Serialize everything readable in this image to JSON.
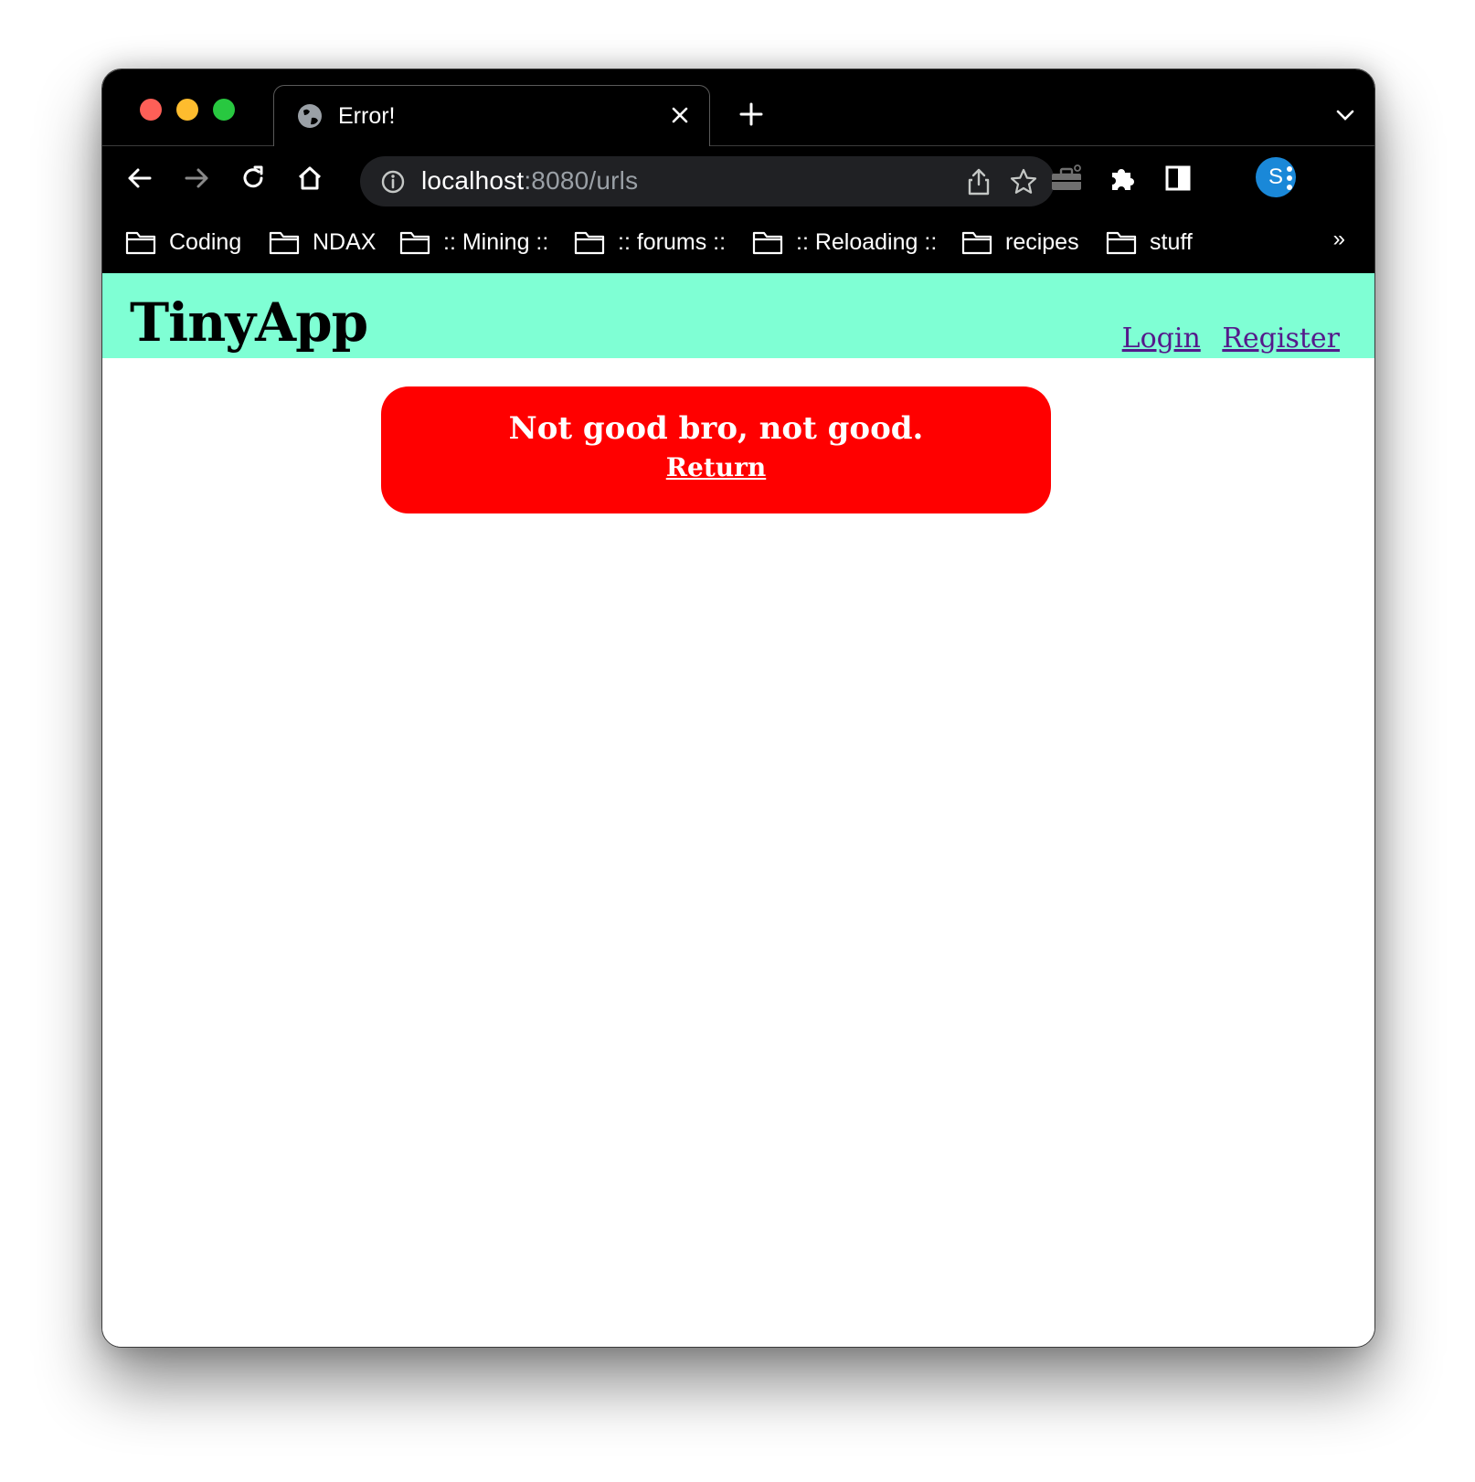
{
  "browser": {
    "tab": {
      "title": "Error!"
    },
    "address_bar": {
      "host": "localhost",
      "rest": ":8080/urls"
    },
    "profile_initial": "S",
    "bookmarks": [
      {
        "label": "Coding"
      },
      {
        "label": "NDAX"
      },
      {
        "label": ":: Mining ::"
      },
      {
        "label": ":: forums ::"
      },
      {
        "label": ":: Reloading ::"
      },
      {
        "label": "recipes"
      },
      {
        "label": "stuff"
      }
    ],
    "bookmarks_overflow": "»"
  },
  "app": {
    "brand": "TinyApp",
    "nav": {
      "login": "Login",
      "register": "Register"
    },
    "header_color": "#7fffd4"
  },
  "error": {
    "message": "Not good bro, not good.",
    "link_label": "Return",
    "color": "#ff0000"
  }
}
